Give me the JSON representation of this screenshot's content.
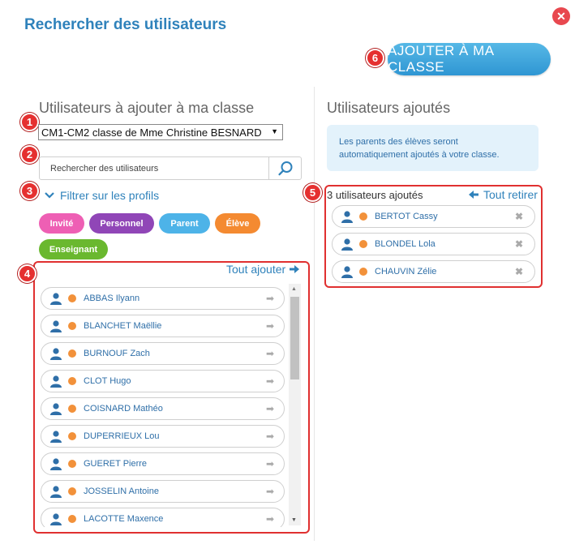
{
  "dialog": {
    "title": "Rechercher des utilisateurs",
    "close_symbol": "✕",
    "add_to_class_label": "AJOUTER À MA CLASSE"
  },
  "left": {
    "section_title": "Utilisateurs à ajouter à ma classe",
    "class_select_value": "CM1-CM2 classe de Mme Christine BESNARD",
    "search_placeholder": "Rechercher des utilisateurs",
    "filter_label": "Filtrer sur les profils",
    "profile_chips": [
      {
        "label": "Invité",
        "color": "#ee5fb4"
      },
      {
        "label": "Personnel",
        "color": "#9046b7"
      },
      {
        "label": "Parent",
        "color": "#4db3e8"
      },
      {
        "label": "Élève",
        "color": "#f48a31"
      },
      {
        "label": "Enseignant",
        "color": "#6ab82f"
      }
    ],
    "add_all_label": "Tout ajouter",
    "users": [
      {
        "name": "ABBAS Ilyann"
      },
      {
        "name": "BLANCHET Maëllie"
      },
      {
        "name": "BURNOUF Zach"
      },
      {
        "name": "CLOT Hugo"
      },
      {
        "name": "COISNARD Mathéo"
      },
      {
        "name": "DUPERRIEUX Lou"
      },
      {
        "name": "GUERET Pierre"
      },
      {
        "name": "JOSSELIN Antoine"
      },
      {
        "name": "LACOTTE Maxence"
      }
    ]
  },
  "right": {
    "section_title": "Utilisateurs ajoutés",
    "info_text": "Les parents des élèves seront automatiquement ajoutés à votre classe.",
    "count_text": "3 utilisateurs ajoutés",
    "remove_all_label": "Tout retirer",
    "added_users": [
      {
        "name": "BERTOT Cassy"
      },
      {
        "name": "BLONDEL Lola"
      },
      {
        "name": "CHAUVIN Zélie"
      }
    ]
  },
  "callouts": [
    "1",
    "2",
    "3",
    "4",
    "5",
    "6"
  ],
  "colors": {
    "accent_blue": "#2f82bb",
    "callout_red": "#e53030",
    "student_dot": "#f2913a"
  }
}
